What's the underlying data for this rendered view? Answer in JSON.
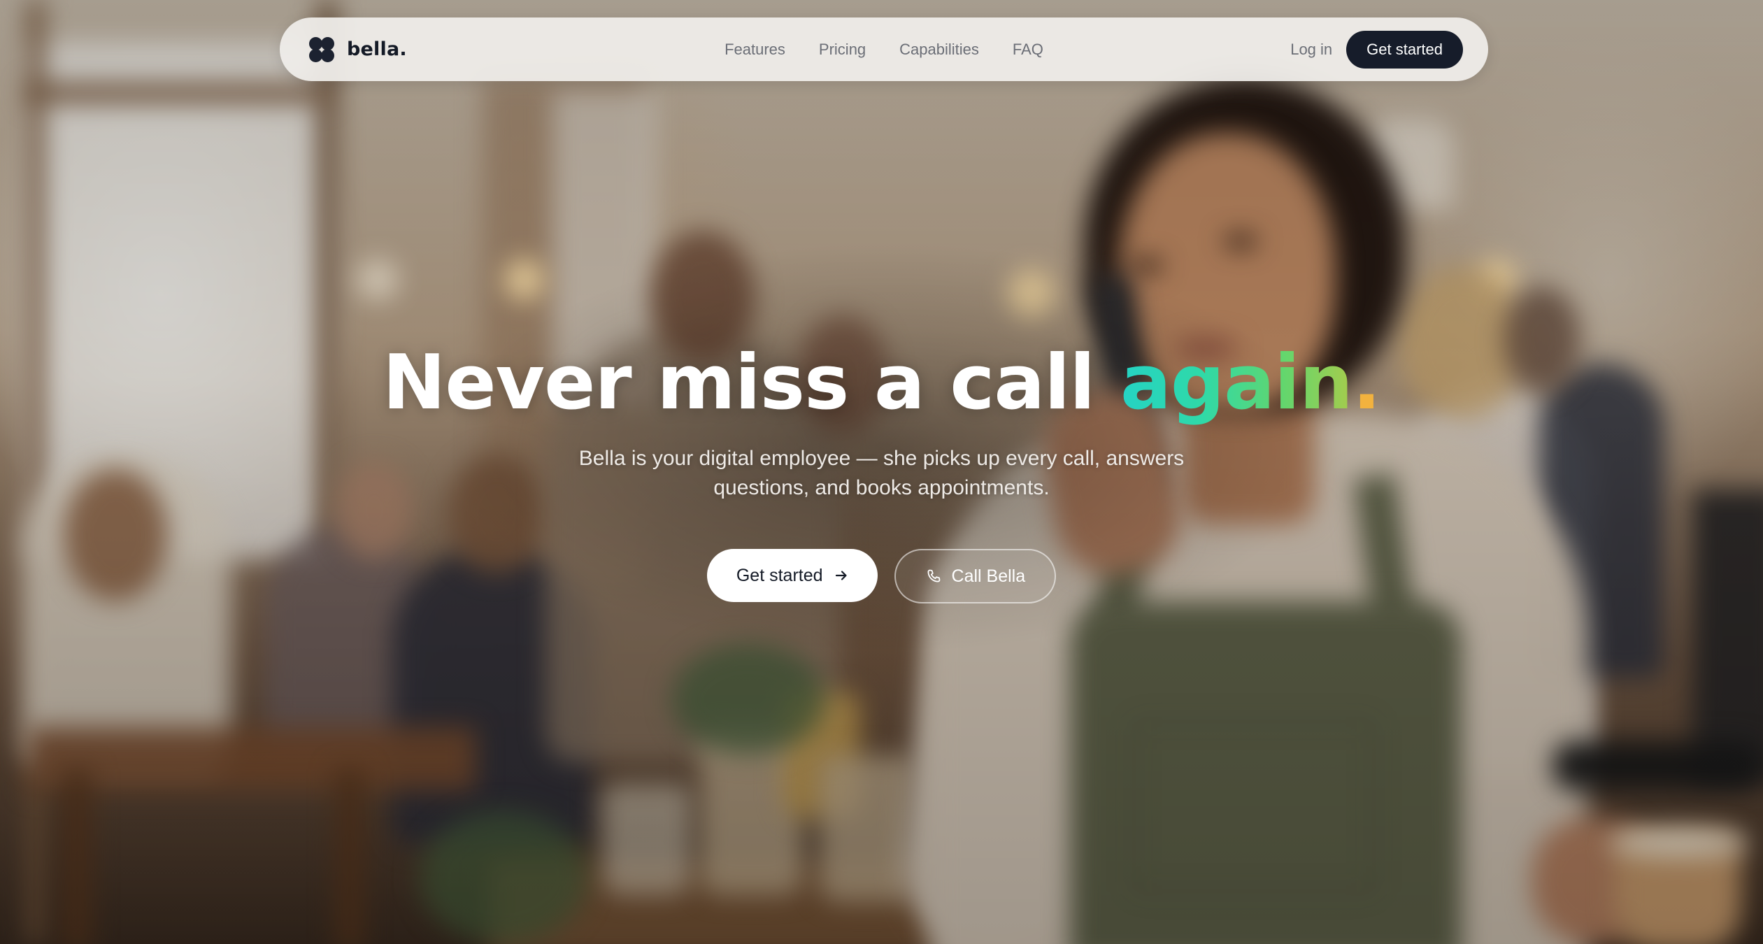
{
  "nav": {
    "brand_name": "bella.",
    "links": [
      "Features",
      "Pricing",
      "Capabilities",
      "FAQ"
    ],
    "login_label": "Log in",
    "cta_label": "Get started"
  },
  "hero": {
    "headline_main": "Never miss a call ",
    "headline_accent": "again",
    "headline_dot": ".",
    "subtext": "Bella is your digital employee — she picks up every call, answers questions, and books appointments.",
    "primary_cta_label": "Get started",
    "secondary_cta_label": "Call Bella"
  },
  "icons": {
    "brand": "four-petal-logo-icon",
    "primary_cta": "arrow-right-icon",
    "secondary_cta": "phone-icon"
  },
  "colors": {
    "accent_gradient": [
      "#25d3c4",
      "#62d66e",
      "#a6cc4c"
    ],
    "dot": "#f2b23e",
    "dark_button": "#161c2a",
    "nav_background": "#f0eeeb"
  },
  "background_image": "blurred cafe scene with smiling woman in apron on phone"
}
